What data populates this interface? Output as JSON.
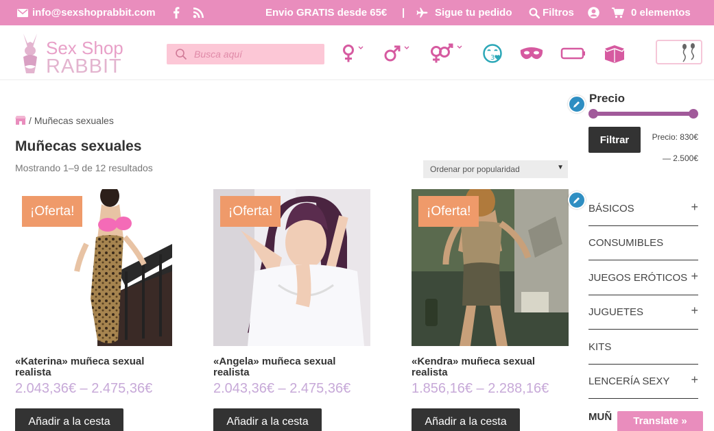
{
  "topbar": {
    "email": "info@sexshoprabbit.com",
    "shipping": "Envio GRATIS desde 65€",
    "separator": "|",
    "track": "Sigue tu pedido",
    "filters": "Filtros",
    "cart": "0 elementos",
    "bg_color": "#e98dbd"
  },
  "header": {
    "logo_line1": "Sex Shop",
    "logo_line2": "RABBIT",
    "search_placeholder": "Busca aquí"
  },
  "breadcrumb": {
    "current": "Muñecas sexuales",
    "separator": "/"
  },
  "page": {
    "title": "Muñecas sexuales",
    "result_count": "Mostrando 1–9 de 12 resultados",
    "sort_selected": "Ordenar por popularidad"
  },
  "products": [
    {
      "badge": "¡Oferta!",
      "title": "«Katerina» muñeca sexual realista",
      "price": "2.043,36€ – 2.475,36€",
      "button": "Añadir a la cesta"
    },
    {
      "badge": "¡Oferta!",
      "title": "«Angela» muñeca sexual realista",
      "price": "2.043,36€ – 2.475,36€",
      "button": "Añadir a la cesta"
    },
    {
      "badge": "¡Oferta!",
      "title": "«Kendra» muñeca sexual realista",
      "price": "1.856,16€ – 2.288,16€",
      "button": "Añadir a la cesta"
    }
  ],
  "sidebar": {
    "price_title": "Precio",
    "filter_button": "Filtrar",
    "price_label": "Precio: 830€",
    "price_max": "— 2.500€",
    "categories": [
      {
        "label": "BÁSICOS",
        "expandable": "+"
      },
      {
        "label": "CONSUMIBLES",
        "expandable": ""
      },
      {
        "label": "JUEGOS ERÓTICOS",
        "expandable": "+"
      },
      {
        "label": "JUGUETES",
        "expandable": "+"
      },
      {
        "label": "KITS",
        "expandable": ""
      },
      {
        "label": "LENCERÍA SEXY",
        "expandable": "+"
      }
    ],
    "cut_category": "MUÑ"
  },
  "translate": {
    "label": "Translate »"
  },
  "colors": {
    "accent_pink": "#e98dbd",
    "price_purple": "#c7a9d8",
    "badge_orange": "#ef9a6a",
    "icon_magenta": "#d65aa0",
    "icon_teal": "#2ba7b7",
    "dark_button": "#333333"
  }
}
